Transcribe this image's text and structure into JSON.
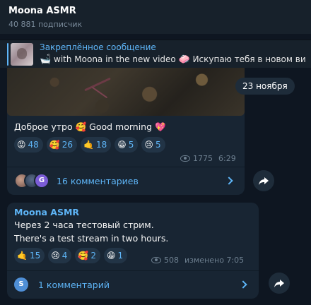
{
  "channel": {
    "title": "Moona ASMR",
    "subscribers": "40 881 подписчик"
  },
  "pinned": {
    "title": "Закреплённое сообщение",
    "text_emoji1": "🛁",
    "text1": " with Moona in the new video ",
    "text_emoji2": "🧼",
    "text2": " Искупаю тебя в новом ви"
  },
  "date_separator": "23 ноября",
  "messages": [
    {
      "text": "Доброе утро 🥰 Good morning 💖",
      "reactions": [
        {
          "emoji": "😡",
          "count": "48"
        },
        {
          "emoji": "🥰",
          "count": "26"
        },
        {
          "emoji": "🤙",
          "count": "18"
        },
        {
          "emoji": "😁",
          "count": "5"
        },
        {
          "emoji": "😢",
          "count": "5"
        }
      ],
      "views": "1775",
      "time": "6:29",
      "avatar3_letter": "G",
      "comments_label": "16 комментариев"
    },
    {
      "author": "Moona ASMR",
      "line1": "Через 2 часа тестовый стрим.",
      "line2": "There's a test stream in two hours.",
      "reactions": [
        {
          "emoji": "🤙",
          "count": "15"
        },
        {
          "emoji": "😢",
          "count": "4"
        },
        {
          "emoji": "🥰",
          "count": "2"
        },
        {
          "emoji": "😁",
          "count": "1"
        }
      ],
      "views": "508",
      "edited_time": "изменено 7:05",
      "avatar_letter": "S",
      "comments_label": "1 комментарий"
    }
  ],
  "colors": {
    "accent": "#5eb5f7",
    "bubble": "#182533",
    "background": "#0e1621"
  }
}
